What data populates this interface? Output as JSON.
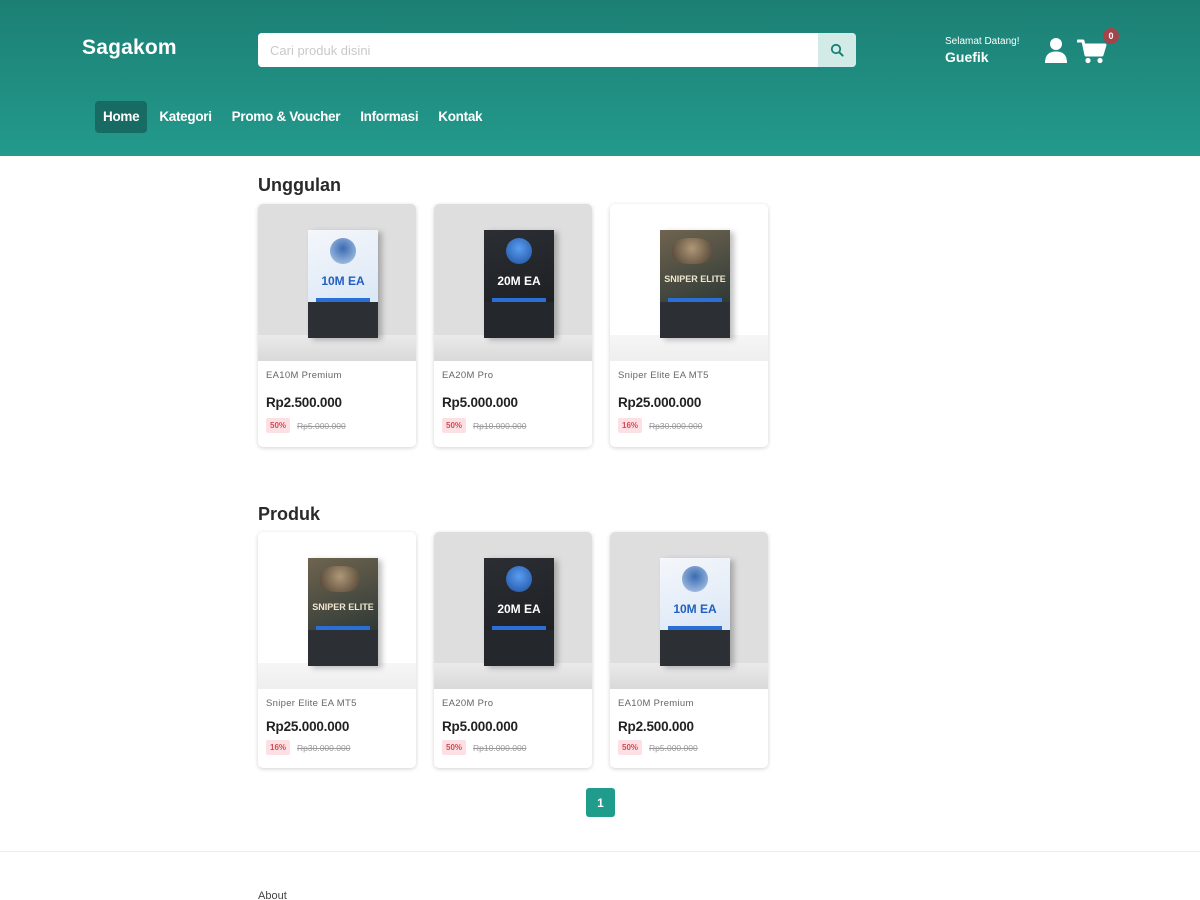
{
  "header": {
    "brand": "Sagakom",
    "search_placeholder": "Cari produk disini",
    "search_icon": "search-icon",
    "greeting": "Selamat Datang!",
    "username": "Guefik",
    "user_icon": "user-icon",
    "cart_icon": "cart-icon",
    "cart_count": "0",
    "color_primary": "#239a8c",
    "color_nav_active": "#176b62"
  },
  "nav": {
    "items": [
      {
        "label": "Home",
        "active": true
      },
      {
        "label": "Kategori"
      },
      {
        "label": "Promo & Voucher"
      },
      {
        "label": "Informasi"
      },
      {
        "label": "Kontak"
      }
    ]
  },
  "featured": {
    "title": "Unggulan",
    "products": [
      {
        "name": "EA10M Premium",
        "price": "Rp2.500.000",
        "discount": "50%",
        "original_price": "Rp5.000.000",
        "box_label": "10M EA"
      },
      {
        "name": "EA20M Pro",
        "price": "Rp5.000.000",
        "discount": "50%",
        "original_price": "Rp10.000.000",
        "box_label": "20M EA"
      },
      {
        "name": "Sniper Elite EA MT5",
        "price": "Rp25.000.000",
        "discount": "16%",
        "original_price": "Rp30.000.000",
        "box_label": "SNIPER ELITE"
      }
    ]
  },
  "products": {
    "title": "Produk",
    "products": [
      {
        "name": "Sniper Elite EA MT5",
        "price": "Rp25.000.000",
        "discount": "16%",
        "original_price": "Rp30.000.000",
        "box_label": "SNIPER ELITE"
      },
      {
        "name": "EA20M Pro",
        "price": "Rp5.000.000",
        "discount": "50%",
        "original_price": "Rp10.000.000",
        "box_label": "20M EA"
      },
      {
        "name": "EA10M Premium",
        "price": "Rp2.500.000",
        "discount": "50%",
        "original_price": "Rp5.000.000",
        "box_label": "10M EA"
      }
    ]
  },
  "pagination": {
    "current_page": "1"
  },
  "footer": {
    "about_label": "About"
  }
}
